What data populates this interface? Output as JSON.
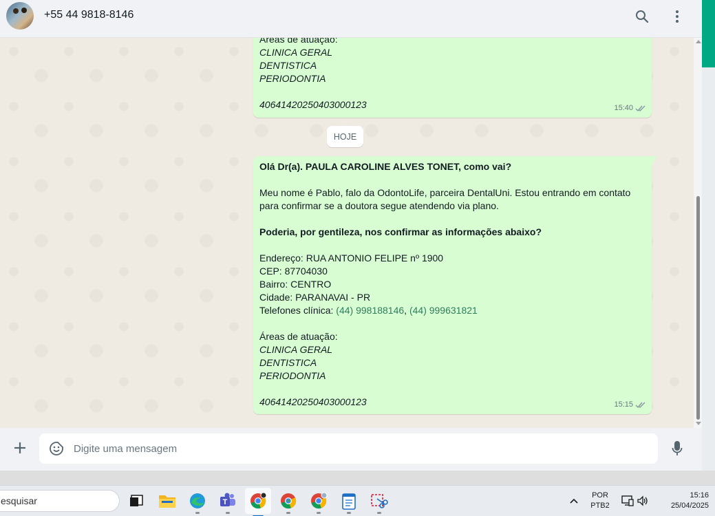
{
  "header": {
    "contact_name": "+55 44 9818-8146"
  },
  "messages": {
    "date_divider": "HOJE",
    "bubble1": {
      "lines": [
        {
          "text": "Áreas de atuação:",
          "style": "normal"
        },
        {
          "text": "CLINICA GERAL",
          "style": "italic"
        },
        {
          "text": "DENTISTICA",
          "style": "italic"
        },
        {
          "text": "PERIODONTIA",
          "style": "italic"
        },
        {
          "text": "",
          "style": "normal"
        },
        {
          "text": "40641420250403000123",
          "style": "italic"
        }
      ],
      "time": "15:40"
    },
    "bubble2": {
      "greeting": "Olá Dr(a). PAULA CAROLINE ALVES TONET, como vai?",
      "intro_1": "Meu nome é Pablo, falo da OdontoLife, parceira DentalUni. Estou entrando em contato",
      "intro_2": "para confirmar se a doutora segue atendendo via plano.",
      "question": "Poderia, por gentileza, nos confirmar as informações abaixo?",
      "address": "Endereço: RUA ANTONIO FELIPE nº 1900",
      "cep": "CEP: 87704030",
      "bairro": "Bairro: CENTRO",
      "cidade": "Cidade: PARANAVAI - PR",
      "phones_label": "Telefones clínica: ",
      "phone_1": "(44) 998188146",
      "phone_sep": ", ",
      "phone_2": "(44) 999631821",
      "areas_label": "Áreas de atuação:",
      "area_1": "CLINICA GERAL",
      "area_2": "DENTISTICA",
      "area_3": "PERIODONTIA",
      "code": "40641420250403000123",
      "time": "15:15"
    }
  },
  "composer": {
    "placeholder": "Digite uma mensagem"
  },
  "taskbar": {
    "search_text": "esquisar",
    "lang_1": "POR",
    "lang_2": "PTB2",
    "clock_time": "15:16",
    "clock_date": "25/04/2025"
  },
  "colors": {
    "bubble_out": "#d9fdd3",
    "accent_green": "#00a884",
    "chat_bg": "#efeae2",
    "link_green": "#2e7d5b"
  },
  "icons": [
    "search-icon",
    "menu-dots-icon",
    "plus-icon",
    "emoji-icon",
    "mic-icon",
    "double-check-icon"
  ]
}
